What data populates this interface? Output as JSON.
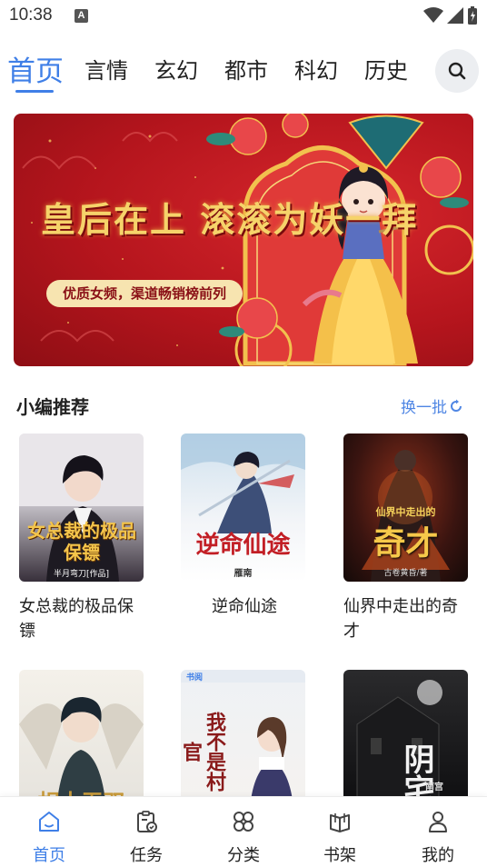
{
  "status_bar": {
    "time": "10:38",
    "notif_letter": "A"
  },
  "top_nav": {
    "tabs": [
      {
        "label": "首页",
        "active": true
      },
      {
        "label": "言情"
      },
      {
        "label": "玄幻"
      },
      {
        "label": "都市"
      },
      {
        "label": "科幻"
      },
      {
        "label": "历史"
      }
    ],
    "search_icon": "search-icon"
  },
  "banner": {
    "title": "皇后在上 滚滚为妖一拜",
    "subtitle": "优质女频，渠道畅销榜前列"
  },
  "recommend": {
    "title": "小编推荐",
    "refresh_label": "换一批",
    "books": [
      {
        "title": "女总裁的极品保镖",
        "cover_title": "女总裁的极品保镖",
        "cover_author": "半月弯刀[作品]"
      },
      {
        "title": "逆命仙途",
        "cover_title": "逆命仙途",
        "cover_author": "雁南"
      },
      {
        "title": "仙界中走出的奇才",
        "cover_title": "奇才",
        "cover_top": "仙界中走出的",
        "cover_author": "古卷黄昏/著"
      },
      {
        "title": "",
        "cover_title": "相士无双"
      },
      {
        "title": "",
        "cover_title": "我不是村官",
        "cover_top": "书阅"
      },
      {
        "title": "",
        "cover_title": "阴宅",
        "cover_author": "南宫"
      }
    ]
  },
  "bottom_nav": {
    "items": [
      {
        "label": "首页",
        "icon": "home-icon",
        "active": true
      },
      {
        "label": "任务",
        "icon": "task-clipboard-icon"
      },
      {
        "label": "分类",
        "icon": "category-grid-icon"
      },
      {
        "label": "书架",
        "icon": "bookshelf-icon"
      },
      {
        "label": "我的",
        "icon": "profile-icon"
      }
    ]
  },
  "colors": {
    "accent": "#3f7fe7",
    "banner_red": "#c41a22",
    "gold": "#f6d36a"
  }
}
